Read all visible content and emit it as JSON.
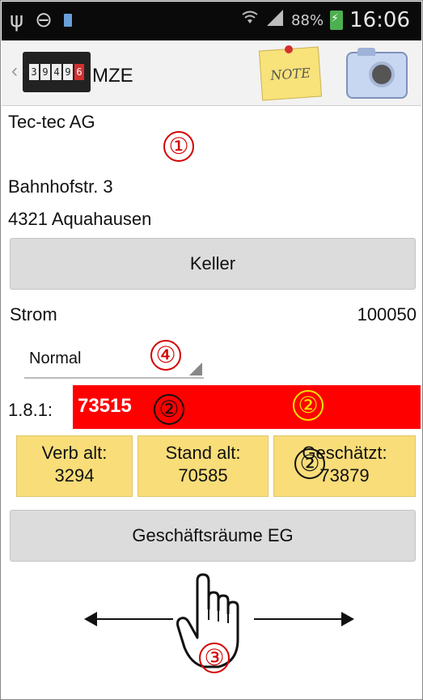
{
  "status_bar": {
    "icons_left": [
      "usb-icon",
      "do-not-disturb-icon",
      "sim-icon"
    ],
    "icons_right": [
      "wifi-icon",
      "signal-icon"
    ],
    "battery_percent": "88%",
    "time": "16:06"
  },
  "action_bar": {
    "title": "MZE",
    "logo_digits": [
      "3",
      "9",
      "4",
      "9",
      "6"
    ],
    "note_label": "NOTE"
  },
  "customer": {
    "name": "Tec-tec AG",
    "street": "Bahnhofstr. 3",
    "city": "4321 Aquahausen"
  },
  "location_button": "Keller",
  "meter": {
    "type": "Strom",
    "number": "100050",
    "mode_select": "Normal",
    "obis": "1.8.1:",
    "reading": "73515"
  },
  "info": {
    "consumption_old_label": "Verb alt:",
    "consumption_old_value": "3294",
    "reading_old_label": "Stand alt:",
    "reading_old_value": "70585",
    "estimated_label": "Geschätzt:",
    "estimated_value": "73879"
  },
  "next_location_button": "Geschäftsräume EG",
  "markers": {
    "m1": "①",
    "m2": "②",
    "m3": "③",
    "m4": "④"
  },
  "colors": {
    "reading_field": "#ff0000",
    "info_background": "#f8dd79",
    "marker_red": "#d40000",
    "marker_yellow": "#f5e400"
  }
}
